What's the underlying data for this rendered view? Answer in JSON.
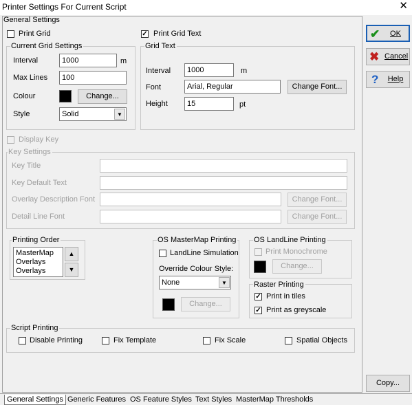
{
  "window": {
    "title": "Printer Settings For Current Script",
    "close": "✕"
  },
  "general": {
    "legend": "General Settings",
    "print_grid": {
      "label": "Print Grid",
      "checked": false
    },
    "print_grid_text": {
      "label": "Print Grid Text",
      "checked": true
    }
  },
  "current_grid": {
    "legend": "Current Grid Settings",
    "interval_label": "Interval",
    "interval_value": "1000",
    "interval_unit": "m",
    "maxlines_label": "Max Lines",
    "maxlines_value": "100",
    "colour_label": "Colour",
    "colour_value": "#000000",
    "change_label": "Change...",
    "style_label": "Style",
    "style_value": "Solid"
  },
  "grid_text": {
    "legend": "Grid Text",
    "interval_label": "Interval",
    "interval_value": "1000",
    "interval_unit": "m",
    "font_label": "Font",
    "font_value": "Arial, Regular",
    "change_font_label": "Change Font...",
    "height_label": "Height",
    "height_value": "15",
    "height_unit": "pt"
  },
  "display_key": {
    "label": "Display Key",
    "checked": false
  },
  "key_settings": {
    "legend": "Key Settings",
    "key_title_label": "Key Title",
    "key_default_text_label": "Key Default Text",
    "overlay_desc_font_label": "Overlay Description Font",
    "detail_line_font_label": "Detail Line Font",
    "change_font_label": "Change Font..."
  },
  "printing_order": {
    "legend": "Printing Order",
    "items": [
      "MasterMap",
      "Overlays",
      "Overlays"
    ]
  },
  "os_mastermap": {
    "legend": "OS MasterMap Printing",
    "landline_sim": {
      "label": "LandLine Simulation",
      "checked": false
    },
    "override_label": "Override Colour Style:",
    "override_value": "None",
    "change_label": "Change..."
  },
  "os_landline": {
    "legend": "OS LandLine Printing",
    "print_mono": {
      "label": "Print Monochrome",
      "checked": false
    },
    "change_label": "Change..."
  },
  "raster": {
    "legend": "Raster Printing",
    "tiles": {
      "label": "Print in tiles",
      "checked": true
    },
    "greyscale": {
      "label": "Print as greyscale",
      "checked": true
    }
  },
  "script_printing": {
    "legend": "Script Printing",
    "disable": {
      "label": "Disable Printing",
      "checked": false
    },
    "fix_template": {
      "label": "Fix Template",
      "checked": false
    },
    "fix_scale": {
      "label": "Fix Scale",
      "checked": false
    },
    "spatial": {
      "label": "Spatial Objects",
      "checked": false
    }
  },
  "side": {
    "ok": {
      "label": "OK",
      "icon": "check-icon",
      "color": "#1a8f1a"
    },
    "cancel": {
      "label": "Cancel",
      "icon": "x-icon",
      "color": "#c0201e"
    },
    "help": {
      "label": "Help",
      "icon": "question-icon",
      "color": "#1c5fc4"
    },
    "copy": {
      "label": "Copy..."
    }
  },
  "tabs": [
    "General Settings",
    "Generic Features",
    "OS Feature Styles",
    "Text Styles",
    "MasterMap Thresholds"
  ]
}
